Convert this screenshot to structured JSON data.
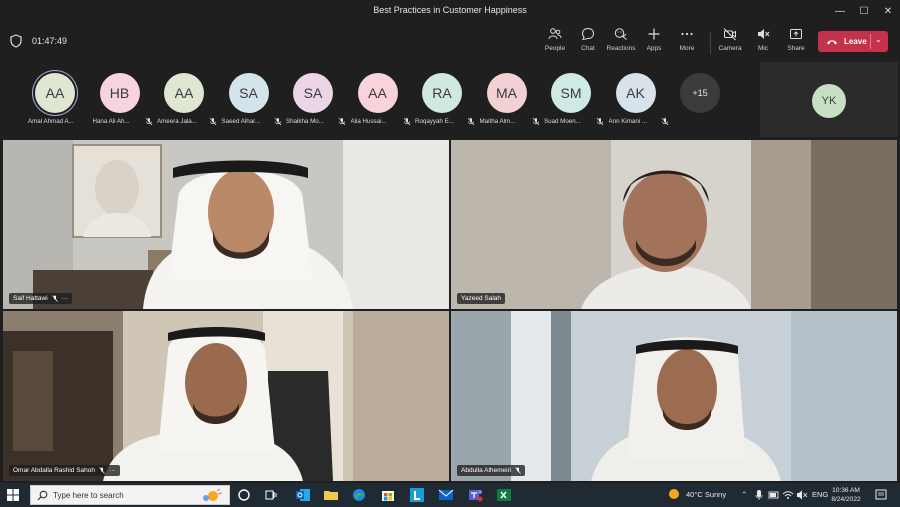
{
  "window": {
    "title": "Best Practices in Customer Happiness",
    "controls": [
      "—",
      "☐",
      "✕"
    ]
  },
  "toolbar": {
    "timer": "01:47:49",
    "buttons": {
      "people": "People",
      "chat": "Chat",
      "reactions": "Reactions",
      "apps": "Apps",
      "more": "More",
      "camera": "Camera",
      "mic": "Mic",
      "share": "Share"
    },
    "leave": "Leave",
    "leave_color": "#c4314b"
  },
  "participants": [
    {
      "initials": "AA",
      "name": "Amal Ahmad A...",
      "color": "#dfe6d2",
      "muted": false
    },
    {
      "initials": "HB",
      "name": "Hana Ali Ah...",
      "color": "#f6d3de",
      "muted": true
    },
    {
      "initials": "AA",
      "name": "Ameera Jala...",
      "color": "#dfe6d2",
      "muted": true
    },
    {
      "initials": "SA",
      "name": "Saeed Alhar...",
      "color": "#d3e4ea",
      "muted": true
    },
    {
      "initials": "SA",
      "name": "Shaikha Mo...",
      "color": "#ecd6e6",
      "muted": true
    },
    {
      "initials": "AA",
      "name": "Alia Hussai...",
      "color": "#f8d3dc",
      "muted": true
    },
    {
      "initials": "RA",
      "name": "Roqayyah E...",
      "color": "#cfe8e1",
      "muted": true
    },
    {
      "initials": "MA",
      "name": "Maitha Alm...",
      "color": "#f2d0d4",
      "muted": true
    },
    {
      "initials": "SM",
      "name": "Suad Moen...",
      "color": "#cfe9e4",
      "muted": true
    },
    {
      "initials": "AK",
      "name": "Ann Kimani ...",
      "color": "#d8e2ea",
      "muted": true
    }
  ],
  "overflow_count": "+15",
  "self": {
    "initials": "YK"
  },
  "videos": [
    {
      "name": "Saif Hattawi",
      "muted": true,
      "more": "···"
    },
    {
      "name": "Yazeed Salah",
      "muted": false,
      "more": ""
    },
    {
      "name": "Omar Abdalla Rashid Sahoh",
      "muted": true,
      "more": "···"
    },
    {
      "name": "Abdulla Alhemeiri",
      "muted": true,
      "more": ""
    }
  ],
  "taskbar": {
    "search_placeholder": "Type here to search",
    "weather": "40°C  Sunny",
    "lang": "ENG",
    "time": "10:36 AM",
    "date": "8/24/2022"
  }
}
